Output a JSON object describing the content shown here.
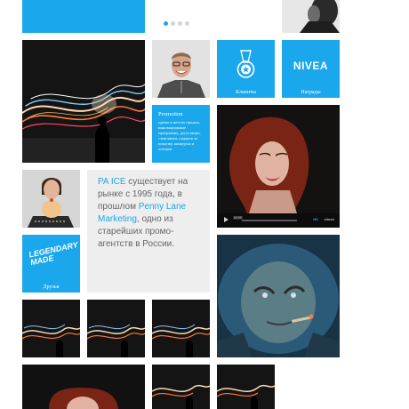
{
  "slider": {
    "slides": 4,
    "active": 1
  },
  "tiles": {
    "clients": {
      "label": "Клиенты",
      "icon": "medal-icon"
    },
    "awards": {
      "label": "Награды",
      "logo_text": "NIVEA"
    },
    "friends": {
      "label": "Друзья",
      "logo_text": "LEGENDARY MADE"
    }
  },
  "promotion": {
    "title": "Promotion",
    "text": "промо в местах продаж, инновационные программы, дегустации, сэмплинги, подарок за покупку, конкурсы и лотереи"
  },
  "about": {
    "brand": "PA ICE",
    "part1": " существует на рынке с 1995 года, в прошлом ",
    "link": "Penny Lane Marketing",
    "part2": ", одно из старейших промо-агентств в России."
  },
  "video": {
    "time": "00:09",
    "hd": "HD",
    "brand": "vimeo"
  },
  "colors": {
    "accent": "#1aa7ec",
    "panel": "#eeeeee"
  }
}
